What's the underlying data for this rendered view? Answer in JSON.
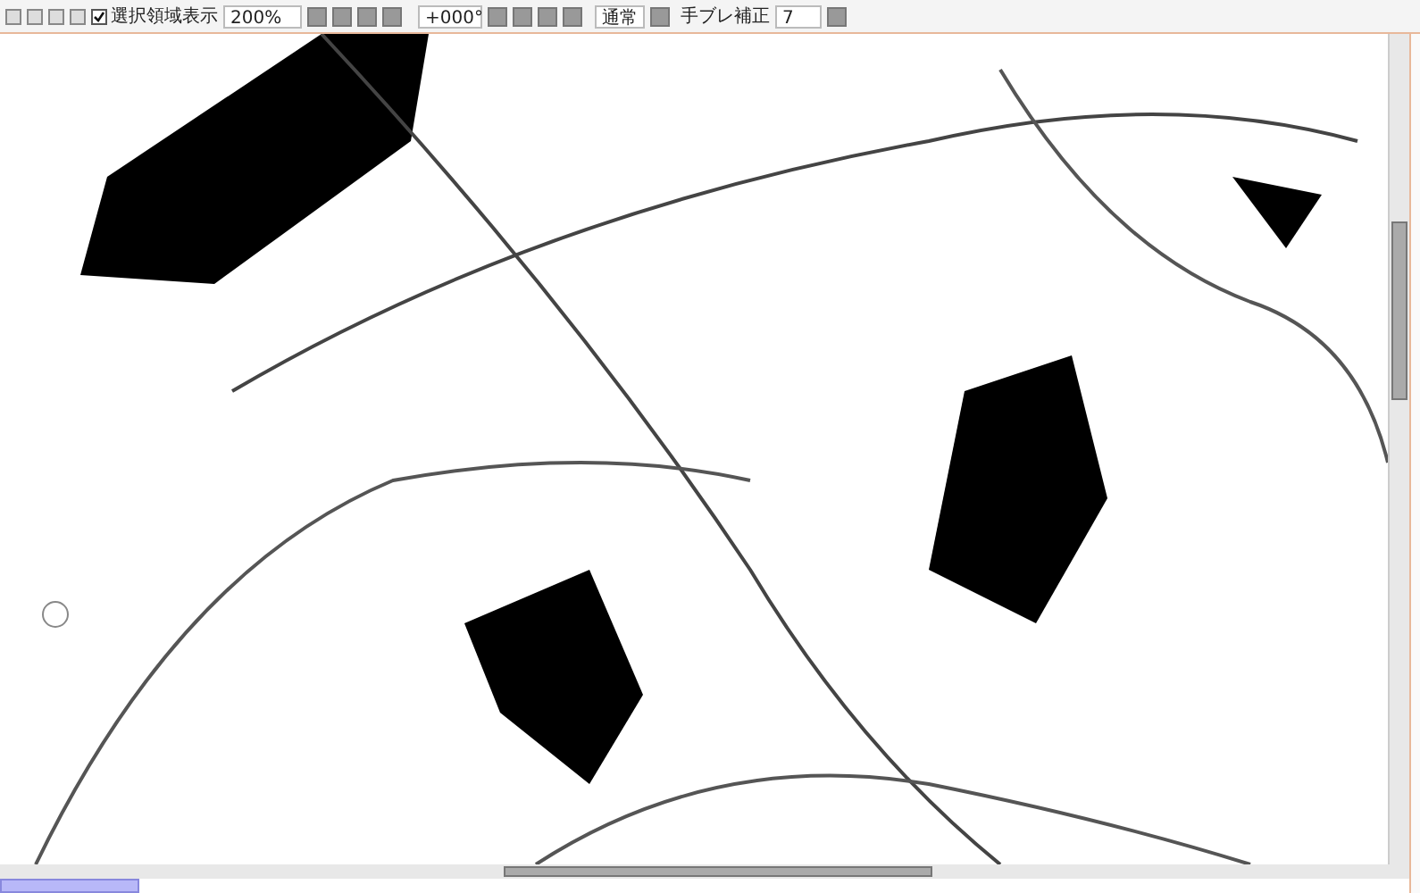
{
  "toolbar": {
    "selection_display": {
      "label": "選択領域表示",
      "checked": true
    },
    "zoom": "200%",
    "angle": "+000°",
    "blend_mode": "通常",
    "stabilizer": {
      "label": "手ブレ補正",
      "value": "7"
    }
  }
}
